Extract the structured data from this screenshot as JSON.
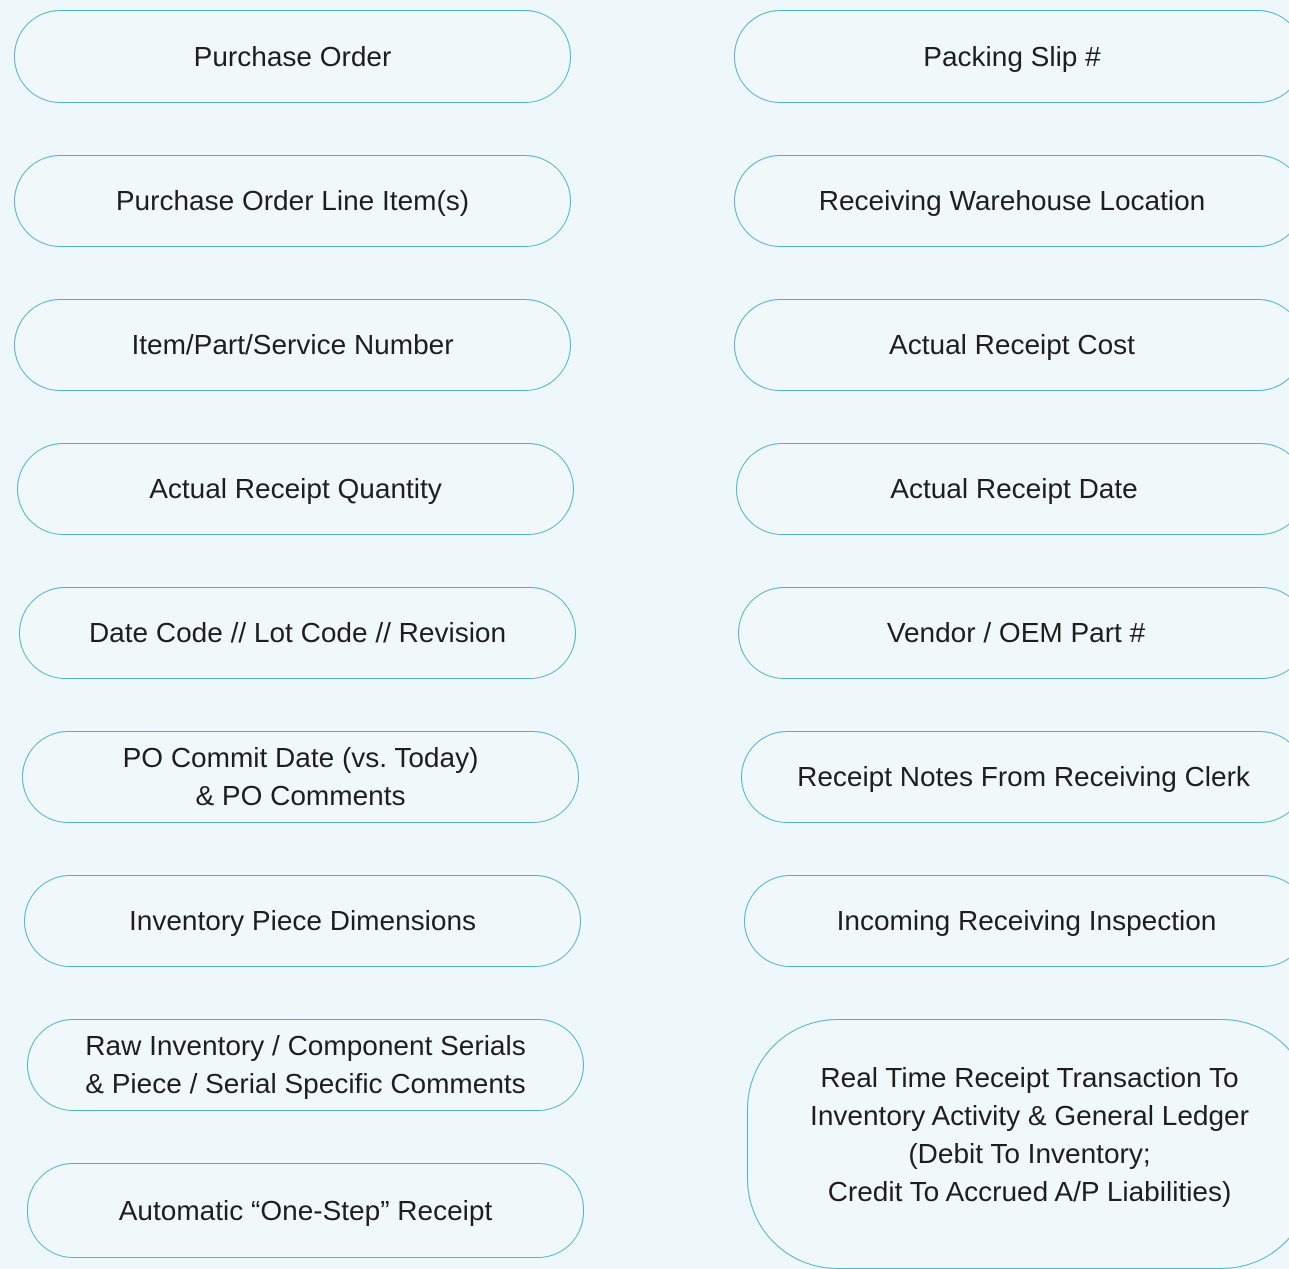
{
  "colors": {
    "background": "#eef7fa",
    "pill_border": "#4fb3c8",
    "text": "#1e1e1e"
  },
  "left_column": [
    "Purchase Order",
    "Purchase Order Line Item(s)",
    "Item/Part/Service Number",
    "Actual Receipt Quantity",
    "Date Code // Lot Code // Revision",
    "PO Commit Date (vs. Today)\n& PO Comments",
    "Inventory Piece Dimensions",
    "Raw Inventory / Component Serials\n& Piece / Serial Specific Comments",
    "Automatic “One-Step” Receipt"
  ],
  "right_column": [
    "Packing Slip #",
    "Receiving Warehouse Location",
    "Actual Receipt Cost",
    "Actual Receipt Date",
    "Vendor / OEM Part #",
    "Receipt Notes From Receiving Clerk",
    "Incoming Receiving Inspection",
    "Real Time Receipt Transaction To\nInventory Activity & General Ledger\n(Debit To Inventory;\nCredit To Accrued A/P Liabilities)"
  ]
}
